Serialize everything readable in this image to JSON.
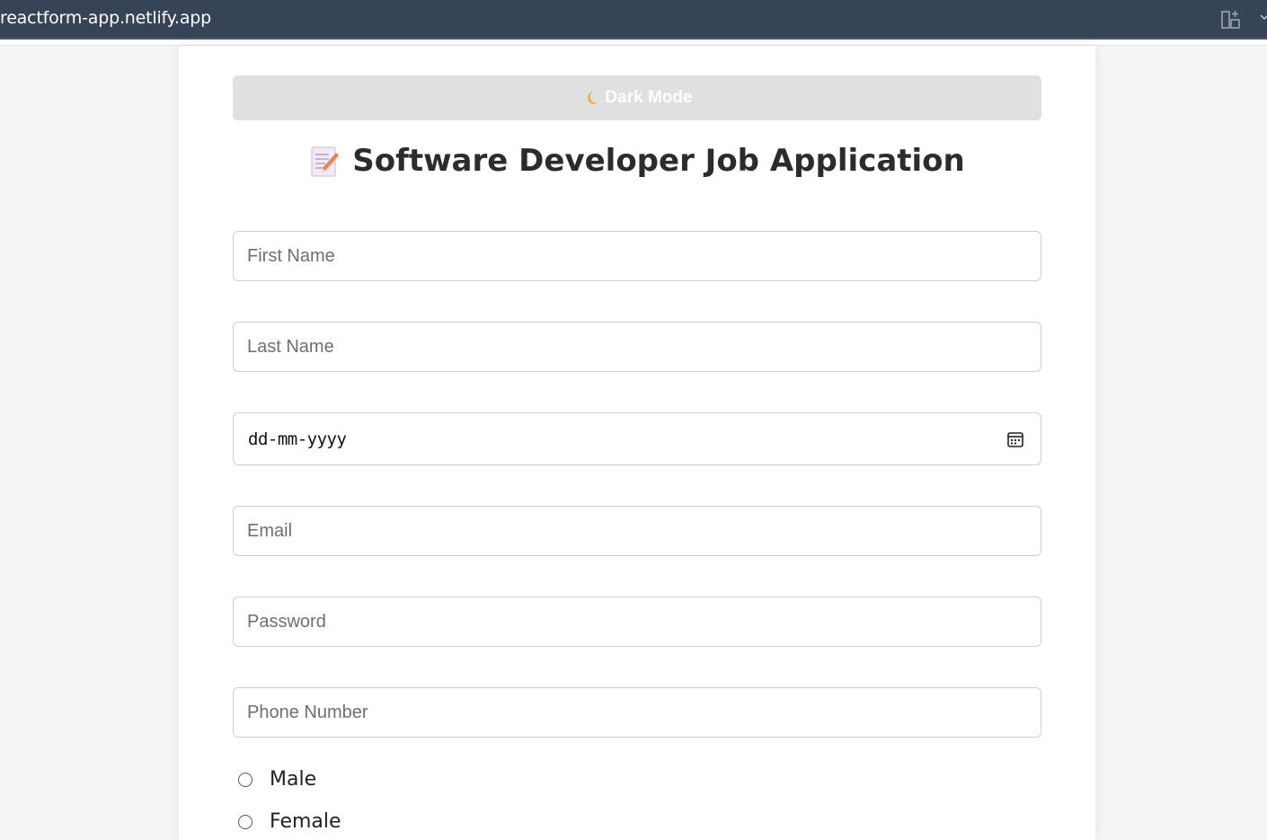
{
  "browser": {
    "url": "reactform-app.netlify.app"
  },
  "theme_toggle": {
    "label": "Dark Mode",
    "icon": "moon-icon"
  },
  "form": {
    "title": "Software Developer Job Application",
    "title_icon": "memo-icon",
    "fields": {
      "first_name": {
        "placeholder": "First Name",
        "value": ""
      },
      "last_name": {
        "placeholder": "Last Name",
        "value": ""
      },
      "date_of_birth": {
        "display": "dd-mm-yyyy",
        "value": ""
      },
      "email": {
        "placeholder": "Email",
        "value": ""
      },
      "password": {
        "placeholder": "Password",
        "value": ""
      },
      "phone": {
        "placeholder": "Phone Number",
        "value": ""
      }
    },
    "gender_options": [
      {
        "label": "Male",
        "checked": false
      },
      {
        "label": "Female",
        "checked": false
      }
    ]
  },
  "colors": {
    "browser_bar": "#374357",
    "toggle_bg": "#e0e0e0",
    "page_bg": "#f5f5f5",
    "card_bg": "#ffffff"
  }
}
